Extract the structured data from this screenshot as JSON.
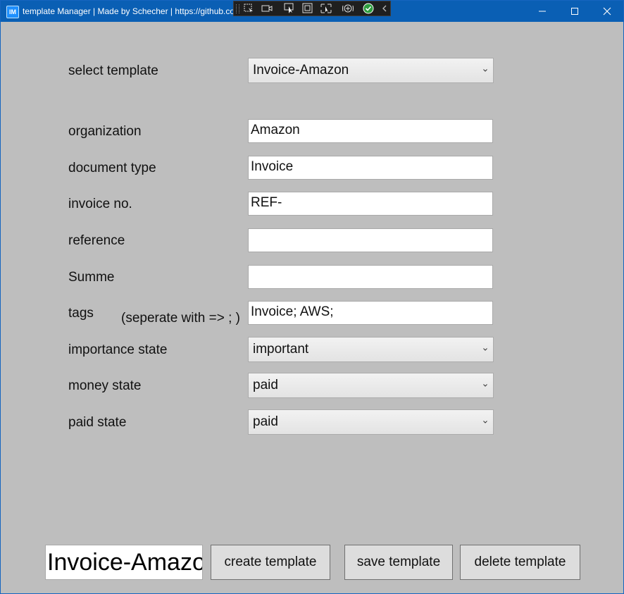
{
  "window": {
    "title": "template Manager | Made by Schecher | https://github.co",
    "app_icon": "IM"
  },
  "debug_toolbar": {
    "icons": [
      "select-element-icon",
      "video-camera-icon",
      "pointer-icon",
      "frame-icon",
      "display-layout-icon",
      "hot-reload-icon",
      "checkmark-icon",
      "collapse-chevron-icon"
    ]
  },
  "form": {
    "select_template": {
      "label": "select template",
      "value": "Invoice-Amazon"
    },
    "organization": {
      "label": "organization",
      "value": "Amazon"
    },
    "document_type": {
      "label": "document type",
      "value": "Invoice"
    },
    "invoice_no": {
      "label": "invoice no.",
      "value": "REF-"
    },
    "reference": {
      "label": "reference",
      "value": ""
    },
    "summe": {
      "label": "Summe",
      "value": ""
    },
    "tags": {
      "label": "tags",
      "hint": "(seperate with => ; )",
      "value": "Invoice; AWS;"
    },
    "importance_state": {
      "label": "importance state",
      "value": "important"
    },
    "money_state": {
      "label": "money state",
      "value": "paid"
    },
    "paid_state": {
      "label": "paid state",
      "value": "paid"
    }
  },
  "footer": {
    "template_name": "Invoice-Amazon",
    "create_button": "create template",
    "save_button": "save template",
    "delete_button": "delete template"
  },
  "colors": {
    "titlebar": "#0a5fb4",
    "background": "#bebebe",
    "check_green": "#2e9e3f"
  }
}
